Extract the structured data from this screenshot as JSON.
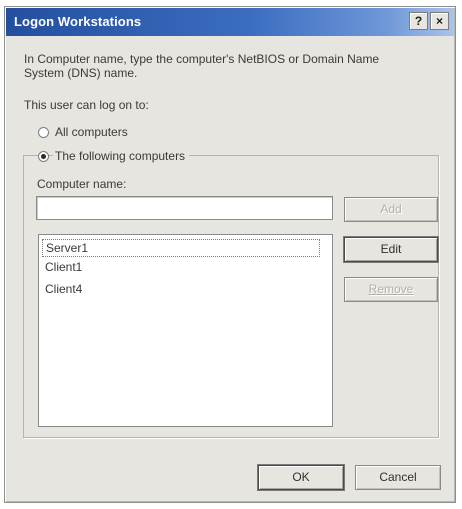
{
  "window": {
    "title": "Logon Workstations",
    "help_button": "?",
    "close_button": "×"
  },
  "instructions": {
    "line1": "In Computer name, type the computer's NetBIOS or Domain Name",
    "line2": "System (DNS) name."
  },
  "logon_label": "This user can log on to:",
  "options": {
    "all_computers": {
      "label": "All computers",
      "selected": false
    },
    "following_computers": {
      "label": "The following computers",
      "selected": true
    }
  },
  "computer_name": {
    "label": "Computer name:",
    "value": "",
    "placeholder": ""
  },
  "computer_list": [
    {
      "name": "Server1",
      "selected": true
    },
    {
      "name": "Client1",
      "selected": false
    },
    {
      "name": "Client4",
      "selected": false
    }
  ],
  "buttons": {
    "add": "Add",
    "edit": "Edit",
    "remove": "Remove",
    "ok": "OK",
    "cancel": "Cancel"
  },
  "colors": {
    "titlebar_start": "#244f9f",
    "titlebar_end": "#aac4ea",
    "dialog_bg": "#e7e5e0"
  }
}
